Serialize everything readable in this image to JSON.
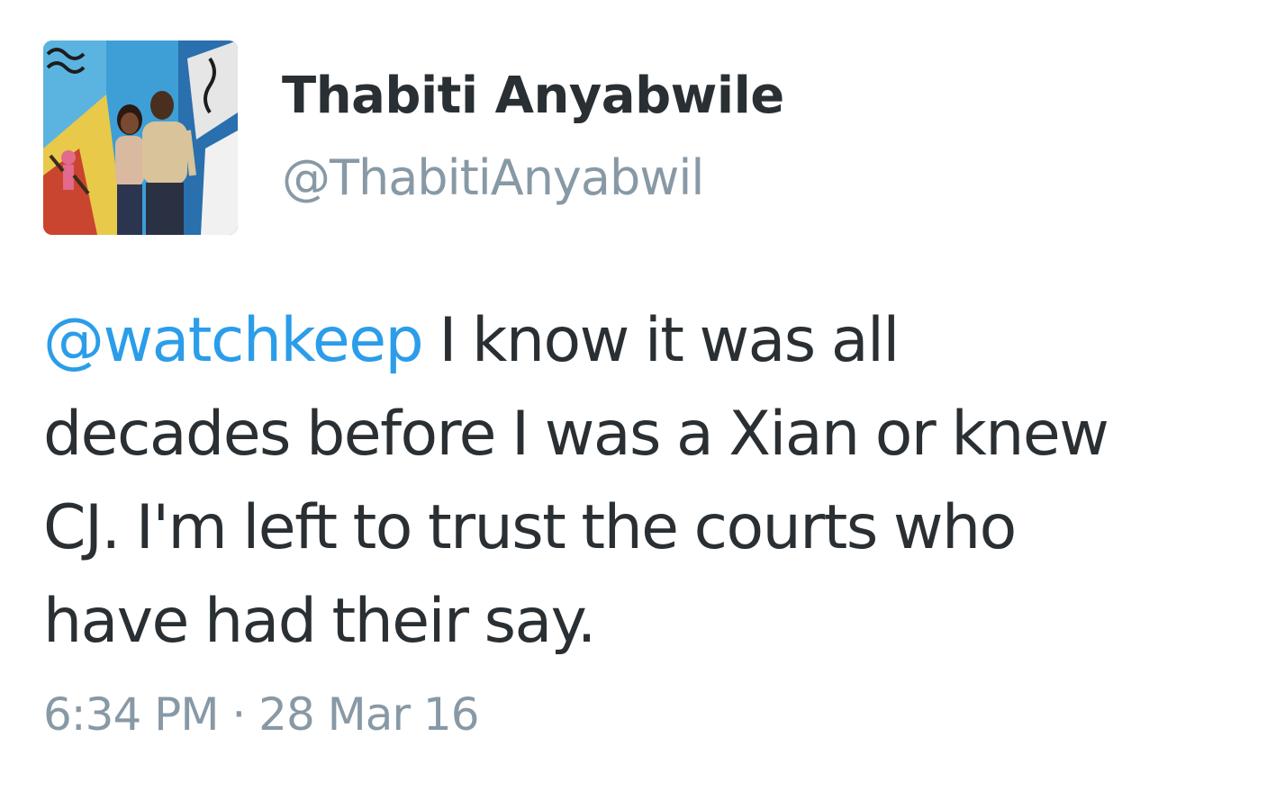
{
  "tweet": {
    "author": {
      "display_name": "Thabiti Anyabwile",
      "handle": "@ThabitiAnyabwil",
      "avatar_description": "profile-photo"
    },
    "text": {
      "mention": "@watchkeep",
      "line1_rest": " I know it was all",
      "line2": "decades before I was a Xian or knew",
      "line3": "CJ. I'm left to trust the courts who",
      "line4": "have had their say."
    },
    "timestamp": "6:34 PM · 28 Mar 16"
  },
  "colors": {
    "name": "#292f33",
    "secondary": "#8899a6",
    "mention": "#2b9de9",
    "background": "#ffffff"
  }
}
